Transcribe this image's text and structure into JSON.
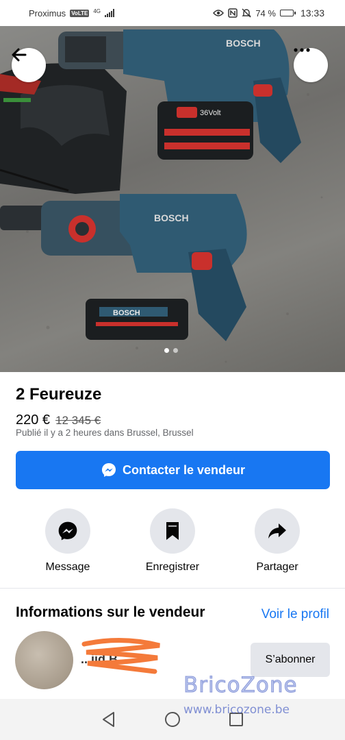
{
  "status_bar": {
    "carrier": "Proximus",
    "volte": "VoLTE",
    "network": "4G",
    "battery": "74 %",
    "battery_level": 0.74,
    "time": "13:33"
  },
  "listing": {
    "title": "2 Feureuze",
    "price": "220 €",
    "old_price": "12 345 €",
    "posted": "Publié il y a 2 heures dans Brussel, Brussel",
    "photo_index": 1,
    "photo_count": 2
  },
  "contact_button": {
    "label": "Contacter le vendeur"
  },
  "actions": [
    {
      "label": "Message",
      "icon": "messenger-icon"
    },
    {
      "label": "Enregistrer",
      "icon": "bookmark-icon"
    },
    {
      "label": "Partager",
      "icon": "share-icon"
    }
  ],
  "seller": {
    "section_title": "Informations sur le vendeur",
    "profile_link": "Voir le profil",
    "name_visible": "...iid B",
    "follow_label": "S’abonner"
  },
  "watermark": {
    "name": "BricoZone",
    "url": "www.bricozone.be"
  },
  "colors": {
    "accent": "#1877f2",
    "chip": "#e4e6eb"
  }
}
